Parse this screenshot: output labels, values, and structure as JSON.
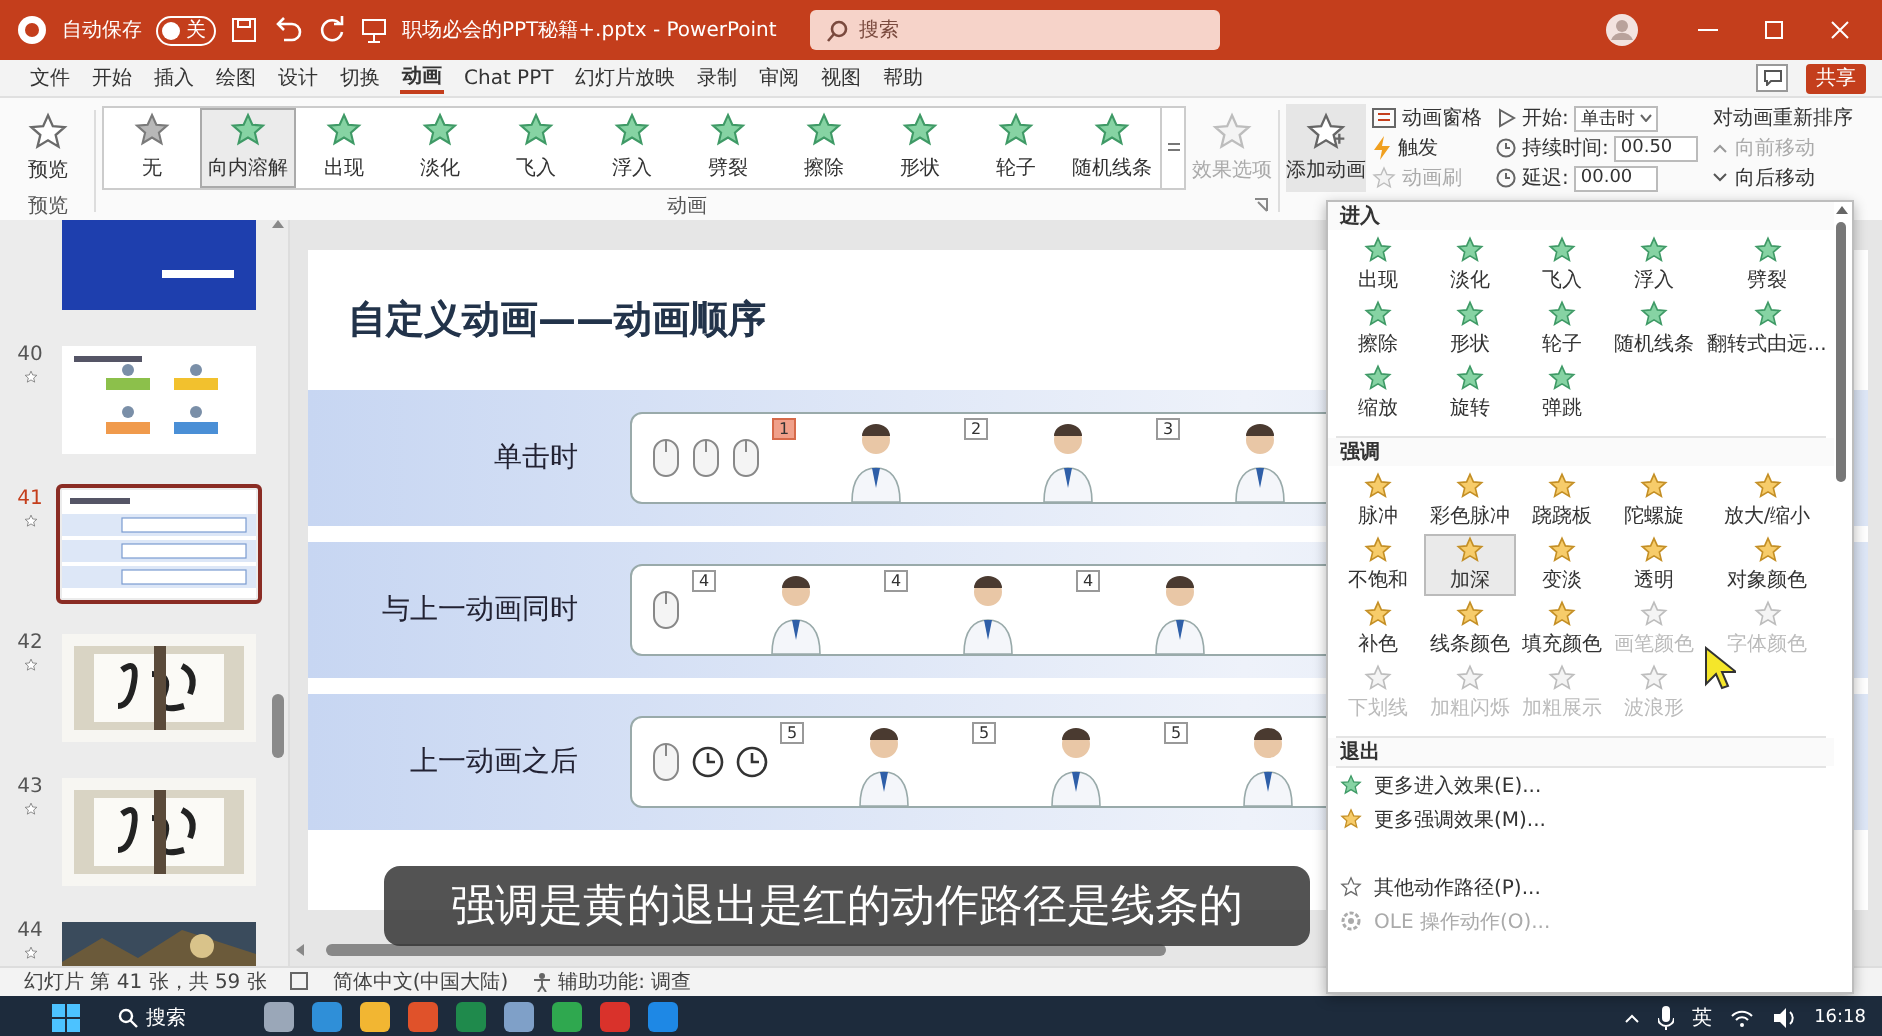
{
  "title_bar": {
    "autosave_label": "自动保存",
    "autosave_on": false,
    "autosave_state": "关",
    "file_title": "职场必会的PPT秘籍+.pptx - PowerPoint",
    "search": {
      "placeholder": "搜索"
    }
  },
  "menu_tabs": [
    {
      "label": "文件",
      "selected": false
    },
    {
      "label": "开始",
      "selected": false
    },
    {
      "label": "插入",
      "selected": false
    },
    {
      "label": "绘图",
      "selected": false
    },
    {
      "label": "设计",
      "selected": false
    },
    {
      "label": "切换",
      "selected": false
    },
    {
      "label": "动画",
      "selected": true
    },
    {
      "label": "Chat PPT",
      "selected": false
    },
    {
      "label": "幻灯片放映",
      "selected": false
    },
    {
      "label": "录制",
      "selected": false
    },
    {
      "label": "审阅",
      "selected": false
    },
    {
      "label": "视图",
      "selected": false
    },
    {
      "label": "帮助",
      "selected": false
    }
  ],
  "share_button": "共享",
  "ribbon": {
    "preview": {
      "label": "预览",
      "group": "预览"
    },
    "effects": [
      {
        "label": "无",
        "kind": "none",
        "selected": false
      },
      {
        "label": "向内溶解",
        "kind": "entrance",
        "selected": true
      },
      {
        "label": "出现",
        "kind": "entrance",
        "selected": false
      },
      {
        "label": "淡化",
        "kind": "entrance",
        "selected": false
      },
      {
        "label": "飞入",
        "kind": "entrance",
        "selected": false
      },
      {
        "label": "浮入",
        "kind": "entrance",
        "selected": false
      },
      {
        "label": "劈裂",
        "kind": "entrance",
        "selected": false
      },
      {
        "label": "擦除",
        "kind": "entrance",
        "selected": false
      },
      {
        "label": "形状",
        "kind": "entrance",
        "selected": false
      },
      {
        "label": "轮子",
        "kind": "entrance",
        "selected": false
      },
      {
        "label": "随机线条",
        "kind": "entrance",
        "selected": false
      }
    ],
    "effects_group": "动画",
    "effect_options": {
      "label": "效果选项",
      "disabled": true
    },
    "add_animation": "添加动画",
    "pane_buttons": [
      {
        "label": "动画窗格",
        "kind": "pane",
        "disabled": false
      },
      {
        "label": "触发",
        "kind": "trigger",
        "disabled": false
      },
      {
        "label": "动画刷",
        "kind": "painter",
        "disabled": true
      }
    ],
    "timing": [
      {
        "label": "开始:",
        "value": "单击时",
        "kind": "dropdown"
      },
      {
        "label": "持续时间:",
        "value": "00.50",
        "kind": "spinner"
      },
      {
        "label": "延迟:",
        "value": "00.00",
        "kind": "spinner"
      }
    ],
    "reorder": {
      "title": "对动画重新排序",
      "items": [
        {
          "label": "向前移动",
          "kind": "up",
          "disabled": true
        },
        {
          "label": "向后移动",
          "kind": "down",
          "disabled": false
        }
      ]
    }
  },
  "thumbnails": [
    {
      "kind": "title",
      "selected": false
    },
    {
      "number": "40",
      "kind": "diagram",
      "selected": false
    },
    {
      "number": "41",
      "kind": "table",
      "selected": true
    },
    {
      "number": "42",
      "kind": "scroll",
      "selected": false
    },
    {
      "number": "43",
      "kind": "scroll",
      "selected": false
    },
    {
      "number": "44",
      "kind": "picture",
      "selected": false
    }
  ],
  "slide": {
    "title": "自定义动画——动画顺序",
    "rows": [
      {
        "label": "单击时",
        "items": [
          {
            "kind": "mouse"
          },
          {
            "kind": "mouse"
          },
          {
            "kind": "mouse"
          },
          {
            "kind": "person",
            "badge": "1",
            "selected": true
          },
          {
            "kind": "person",
            "badge": "2",
            "selected": false
          },
          {
            "kind": "person",
            "badge": "3",
            "selected": false
          }
        ]
      },
      {
        "label": "与上一动画同时",
        "items": [
          {
            "kind": "mouse"
          },
          {
            "kind": "person",
            "badge": "4",
            "selected": false
          },
          {
            "kind": "person",
            "badge": "4",
            "selected": false
          },
          {
            "kind": "person",
            "badge": "4",
            "selected": false
          }
        ]
      },
      {
        "label": "上一动画之后",
        "items": [
          {
            "kind": "mouse"
          },
          {
            "kind": "clock"
          },
          {
            "kind": "clock"
          },
          {
            "kind": "person",
            "badge": "5",
            "selected": false
          },
          {
            "kind": "person",
            "badge": "5",
            "selected": false
          },
          {
            "kind": "person",
            "badge": "5",
            "selected": false
          }
        ]
      }
    ]
  },
  "animation_menu": {
    "sections": [
      {
        "title": "进入",
        "kind": "entrance",
        "effects": [
          {
            "label": "出现",
            "selected": false,
            "disabled": false
          },
          {
            "label": "淡化",
            "selected": false,
            "disabled": false
          },
          {
            "label": "飞入",
            "selected": false,
            "disabled": false
          },
          {
            "label": "浮入",
            "selected": false,
            "disabled": false
          },
          {
            "label": "劈裂",
            "selected": false,
            "disabled": false
          },
          {
            "label": "擦除",
            "selected": false,
            "disabled": false
          },
          {
            "label": "形状",
            "selected": false,
            "disabled": false
          },
          {
            "label": "轮子",
            "selected": false,
            "disabled": false
          },
          {
            "label": "随机线条",
            "selected": false,
            "disabled": false
          },
          {
            "label": "翻转式由远...",
            "selected": false,
            "disabled": false
          },
          {
            "label": "缩放",
            "selected": false,
            "disabled": false
          },
          {
            "label": "旋转",
            "selected": false,
            "disabled": false
          },
          {
            "label": "弹跳",
            "selected": false,
            "disabled": false
          }
        ]
      },
      {
        "title": "强调",
        "kind": "emphasis",
        "effects": [
          {
            "label": "脉冲",
            "selected": false,
            "disabled": false
          },
          {
            "label": "彩色脉冲",
            "selected": false,
            "disabled": false
          },
          {
            "label": "跷跷板",
            "selected": false,
            "disabled": false
          },
          {
            "label": "陀螺旋",
            "selected": false,
            "disabled": false
          },
          {
            "label": "放大/缩小",
            "selected": false,
            "disabled": false
          },
          {
            "label": "不饱和",
            "selected": false,
            "disabled": false
          },
          {
            "label": "加深",
            "selected": true,
            "disabled": false
          },
          {
            "label": "变淡",
            "selected": false,
            "disabled": false
          },
          {
            "label": "透明",
            "selected": false,
            "disabled": false
          },
          {
            "label": "对象颜色",
            "selected": false,
            "disabled": false
          },
          {
            "label": "补色",
            "selected": false,
            "disabled": false
          },
          {
            "label": "线条颜色",
            "selected": false,
            "disabled": false
          },
          {
            "label": "填充颜色",
            "selected": false,
            "disabled": false
          },
          {
            "label": "画笔颜色",
            "selected": false,
            "disabled": true
          },
          {
            "label": "字体颜色",
            "selected": false,
            "disabled": true
          },
          {
            "label": "下划线",
            "selected": false,
            "disabled": true
          },
          {
            "label": "加粗闪烁",
            "selected": false,
            "disabled": true
          },
          {
            "label": "加粗展示",
            "selected": false,
            "disabled": true
          },
          {
            "label": "波浪形",
            "selected": false,
            "disabled": true
          }
        ]
      },
      {
        "title": "退出"
      }
    ],
    "links": [
      {
        "label": "更多进入效果(E)...",
        "kind": "entrance",
        "disabled": false
      },
      {
        "label": "更多强调效果(M)...",
        "kind": "emphasis",
        "disabled": false
      },
      {
        "label": "其他动作路径(P)...",
        "kind": "path",
        "disabled": false
      },
      {
        "label": "OLE 操作动作(O)...",
        "kind": "ole",
        "disabled": true
      }
    ]
  },
  "caption": "强调是黄的退出是红的动作路径是线条的",
  "status_bar": {
    "slide_info": "幻灯片 第 41 张，共 59 张",
    "language": "简体中文(中国大陆)",
    "accessibility": "辅助功能: 调查"
  },
  "taskbar": {
    "search": "搜索",
    "apps": [
      {
        "color": "#9aa7b8"
      },
      {
        "color": "#2f8fd8"
      },
      {
        "color": "#f2b632"
      },
      {
        "color": "#e0522a"
      },
      {
        "color": "#1f8a4c"
      },
      {
        "color": "#7fa0c8"
      },
      {
        "color": "#2fa84f"
      },
      {
        "color": "#d9322b"
      },
      {
        "color": "#1e88e5"
      }
    ],
    "ime": "英",
    "time": "16:18"
  }
}
